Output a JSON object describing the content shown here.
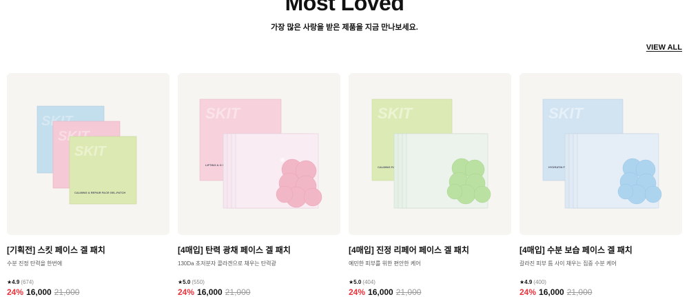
{
  "header": {
    "title": "Most Loved",
    "subtitle": "가장 많은 사랑을 받은 제품을 지금 만나보세요.",
    "view_all": "VIEW ALL"
  },
  "products": [
    {
      "name": "[기획전] 스킷 페이스 겔 패치",
      "desc": "수분 진정 탄력을 한번에",
      "rating": "4.9",
      "reviews": "(674)",
      "discount": "24%",
      "price": "16,000",
      "original_price": "21,000",
      "art": {
        "brand": "SKIT",
        "box_label": "CALMING & REPAIR FACE GEL-PATCH",
        "colors": [
          "#bcdbea",
          "#f4c6d3",
          "#dbe8ae"
        ]
      }
    },
    {
      "name": "[4매입] 탄력 광채 페이스 겔 패치",
      "desc": "130Da 초저분자 콜라겐으로 채우는 탄력광",
      "rating": "5.0",
      "reviews": "(550)",
      "discount": "24%",
      "price": "16,000",
      "original_price": "21,000",
      "art": {
        "brand": "SKIT",
        "box_label": "LIFTING & G FACE GEL-PATC",
        "box_color": "#f6cedb",
        "patch_color": "#f2b7c6"
      }
    },
    {
      "name": "[4매입] 진정 리페어 페이스 겔 패치",
      "desc": "예민한 피부를 위한 편안한 케어",
      "rating": "5.0",
      "reviews": "(404)",
      "discount": "24%",
      "price": "16,000",
      "original_price": "21,000",
      "art": {
        "brand": "SKIT",
        "box_label": "CALMING FACE GEL-",
        "box_color": "#dbe9b4",
        "patch_color": "#b6df9c"
      }
    },
    {
      "name": "[4매입] 수분 보습 페이스 겔 패치",
      "desc": "갈라진 피부 틈 사이 채우는 집중 수분 케어",
      "rating": "4.9",
      "reviews": "(400)",
      "discount": "24%",
      "price": "16,000",
      "original_price": "21,000",
      "art": {
        "brand": "SKIT",
        "box_label": "HYDRATIN FACE GEL-",
        "box_color": "#cfe2f1",
        "patch_color": "#a9d1ee"
      }
    }
  ]
}
